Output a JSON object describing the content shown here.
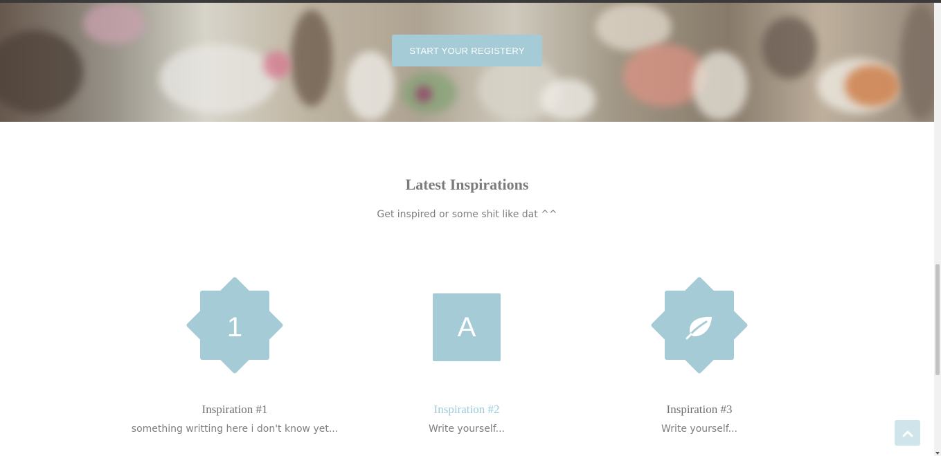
{
  "hero": {
    "cta_label": "START YOUR REGISTERY"
  },
  "inspirations": {
    "title": "Latest Inspirations",
    "subtitle": "Get inspired or some shit like dat ^^",
    "items": [
      {
        "title": "Inspiration #1",
        "text": "something writting here i don't know yet...",
        "icon": "badge-number-icon",
        "icon_text": "1"
      },
      {
        "title": "Inspiration #2",
        "text": "Write yourself...",
        "icon": "square-letter-icon",
        "icon_text": "A"
      },
      {
        "title": "Inspiration #3",
        "text": "Write yourself...",
        "icon": "leaf-icon",
        "icon_text": ""
      }
    ]
  },
  "colors": {
    "accent": "#a5cbd6",
    "active_link": "#9ccbd8",
    "text": "#7e7e7e"
  },
  "scroll_top": {
    "icon": "chevron-up-icon"
  }
}
